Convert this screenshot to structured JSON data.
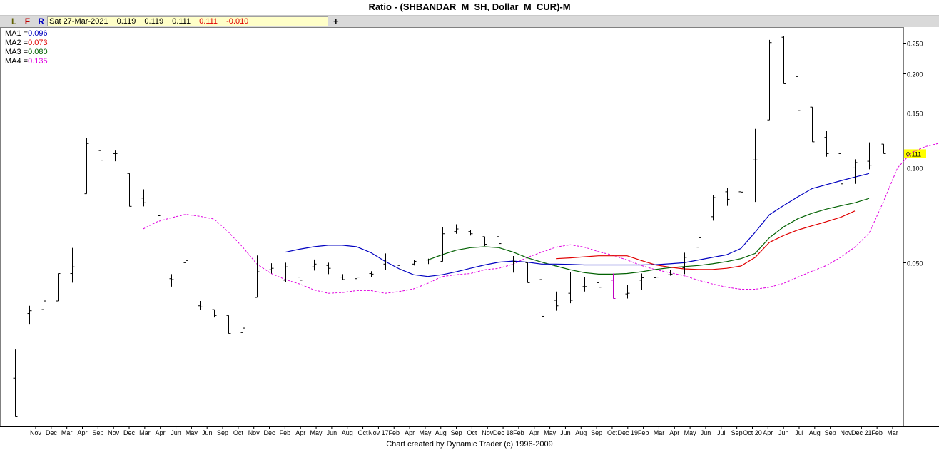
{
  "title": "Ratio - (SHBANDAR_M_SH, Dollar_M_CUR)-M",
  "toolbar": {
    "l": "L",
    "f": "F",
    "r": "R",
    "date": "Sat 27-Mar-2021",
    "open": "0.119",
    "high": "0.119",
    "low": "0.111",
    "close": "0.111",
    "change": "-0.010",
    "crosshair": "+"
  },
  "legend": [
    {
      "label": "MA1 =",
      "value": "0.096",
      "color": "#0000c0"
    },
    {
      "label": "MA2 =",
      "value": "0.073",
      "color": "#e00000"
    },
    {
      "label": "MA3 =",
      "value": "0.080",
      "color": "#006000"
    },
    {
      "label": "MA4 =",
      "value": "0.135",
      "color": "#e000e0"
    }
  ],
  "footer": "Chart created by Dynamic Trader  (c) 1996-2009",
  "chart_data": {
    "type": "ohlc",
    "y_scale": "log",
    "y_ticks": [
      "0.250",
      "0.200",
      "0.150",
      "0.100",
      "0.050"
    ],
    "y_tick_values": [
      0.25,
      0.2,
      0.15,
      0.1,
      0.05
    ],
    "last_price_label": "0.111",
    "last_price_color": "#ffff00",
    "x_labels": [
      "Nov",
      "Dec",
      "Mar",
      "Apr",
      "Sep",
      "Nov",
      "Dec",
      "Mar",
      "Apr",
      "Jun",
      "May",
      "Jun",
      "Sep",
      "Oct",
      "Nov",
      "Dec",
      "Feb",
      "Apr",
      "May",
      "Jun",
      "Aug",
      "Oct",
      "Nov 17",
      "Feb",
      "Apr",
      "May",
      "Aug",
      "Sep",
      "Oct",
      "Nov",
      "Dec 18",
      "Feb",
      "Apr",
      "May",
      "Jun",
      "Aug",
      "Sep",
      "Oct",
      "Dec 19",
      "Feb",
      "Mar",
      "Apr",
      "May",
      "Jun",
      "Jul",
      "Sep",
      "Oct 20",
      "Apr",
      "Jun",
      "Jul",
      "Aug",
      "Sep",
      "Nov",
      "Dec 21",
      "Feb",
      "Mar"
    ],
    "bars": [
      {
        "o": 0.0215,
        "h": 0.0265,
        "l": 0.0162,
        "c": 0.0162
      },
      {
        "o": 0.0345,
        "h": 0.0365,
        "l": 0.0318,
        "c": 0.0352
      },
      {
        "o": 0.0355,
        "h": 0.0382,
        "l": 0.0352,
        "c": 0.0378
      },
      {
        "o": 0.0378,
        "h": 0.0462,
        "l": 0.0378,
        "c": 0.0462
      },
      {
        "o": 0.0462,
        "h": 0.0557,
        "l": 0.0432,
        "c": 0.0485
      },
      {
        "o": 0.0828,
        "h": 0.1248,
        "l": 0.0828,
        "c": 0.1195
      },
      {
        "o": 0.1135,
        "h": 0.1165,
        "l": 0.1045,
        "c": 0.1058
      },
      {
        "o": 0.111,
        "h": 0.1135,
        "l": 0.105,
        "c": 0.111
      },
      {
        "o": 0.096,
        "h": 0.096,
        "l": 0.0755,
        "c": 0.0755
      },
      {
        "o": 0.0802,
        "h": 0.0855,
        "l": 0.0755,
        "c": 0.0775
      },
      {
        "o": 0.0735,
        "h": 0.0735,
        "l": 0.0668,
        "c": 0.0705
      },
      {
        "o": 0.0445,
        "h": 0.046,
        "l": 0.042,
        "c": 0.0442
      },
      {
        "o": 0.05,
        "h": 0.0562,
        "l": 0.0442,
        "c": 0.0508
      },
      {
        "o": 0.0365,
        "h": 0.0378,
        "l": 0.0355,
        "c": 0.0362
      },
      {
        "o": 0.0355,
        "h": 0.0355,
        "l": 0.0335,
        "c": 0.034
      },
      {
        "o": 0.034,
        "h": 0.034,
        "l": 0.0298,
        "c": 0.0298
      },
      {
        "o": 0.03,
        "h": 0.0318,
        "l": 0.0292,
        "c": 0.031
      },
      {
        "o": 0.0388,
        "h": 0.0527,
        "l": 0.0388,
        "c": 0.0468
      },
      {
        "o": 0.0475,
        "h": 0.0498,
        "l": 0.0462,
        "c": 0.048
      },
      {
        "o": 0.044,
        "h": 0.05,
        "l": 0.0435,
        "c": 0.0485
      },
      {
        "o": 0.045,
        "h": 0.046,
        "l": 0.0432,
        "c": 0.044
      },
      {
        "o": 0.0485,
        "h": 0.0512,
        "l": 0.0472,
        "c": 0.0495
      },
      {
        "o": 0.049,
        "h": 0.05,
        "l": 0.046,
        "c": 0.048
      },
      {
        "o": 0.045,
        "h": 0.046,
        "l": 0.0442,
        "c": 0.0442
      },
      {
        "o": 0.0445,
        "h": 0.0455,
        "l": 0.0442,
        "c": 0.045
      },
      {
        "o": 0.0462,
        "h": 0.047,
        "l": 0.045,
        "c": 0.046
      },
      {
        "o": 0.0495,
        "h": 0.0535,
        "l": 0.0475,
        "c": 0.051
      },
      {
        "o": 0.049,
        "h": 0.0505,
        "l": 0.0465,
        "c": 0.0475
      },
      {
        "o": 0.0495,
        "h": 0.051,
        "l": 0.049,
        "c": 0.0505
      },
      {
        "o": 0.051,
        "h": 0.0515,
        "l": 0.0495,
        "c": 0.051
      },
      {
        "o": 0.0505,
        "h": 0.065,
        "l": 0.0505,
        "c": 0.0618
      },
      {
        "o": 0.0628,
        "h": 0.0662,
        "l": 0.0618,
        "c": 0.064
      },
      {
        "o": 0.0628,
        "h": 0.0635,
        "l": 0.061,
        "c": 0.0618
      },
      {
        "o": 0.0605,
        "h": 0.0605,
        "l": 0.0565,
        "c": 0.0572
      },
      {
        "o": 0.0605,
        "h": 0.0605,
        "l": 0.0572,
        "c": 0.0575
      },
      {
        "o": 0.051,
        "h": 0.0525,
        "l": 0.0465,
        "c": 0.0505
      },
      {
        "o": 0.05,
        "h": 0.05,
        "l": 0.0432,
        "c": 0.0432
      },
      {
        "o": 0.0442,
        "h": 0.0442,
        "l": 0.0338,
        "c": 0.0338
      },
      {
        "o": 0.038,
        "h": 0.0405,
        "l": 0.0352,
        "c": 0.0365
      },
      {
        "o": 0.04,
        "h": 0.0468,
        "l": 0.0372,
        "c": 0.038
      },
      {
        "o": 0.042,
        "h": 0.045,
        "l": 0.0405,
        "c": 0.042
      },
      {
        "o": 0.0432,
        "h": 0.0458,
        "l": 0.041,
        "c": 0.0418
      },
      {
        "o": 0.044,
        "h": 0.0462,
        "l": 0.0385,
        "c": 0.0385
      },
      {
        "o": 0.0398,
        "h": 0.0425,
        "l": 0.0385,
        "c": 0.04
      },
      {
        "o": 0.044,
        "h": 0.0462,
        "l": 0.041,
        "c": 0.0448
      },
      {
        "o": 0.0448,
        "h": 0.0462,
        "l": 0.0435,
        "c": 0.045
      },
      {
        "o": 0.0458,
        "h": 0.0475,
        "l": 0.0455,
        "c": 0.046
      },
      {
        "o": 0.0482,
        "h": 0.0538,
        "l": 0.046,
        "c": 0.052
      },
      {
        "o": 0.056,
        "h": 0.061,
        "l": 0.054,
        "c": 0.06
      },
      {
        "o": 0.07,
        "h": 0.082,
        "l": 0.068,
        "c": 0.0805
      },
      {
        "o": 0.084,
        "h": 0.0865,
        "l": 0.0758,
        "c": 0.0795
      },
      {
        "o": 0.084,
        "h": 0.0865,
        "l": 0.081,
        "c": 0.0838
      },
      {
        "o": 0.106,
        "h": 0.133,
        "l": 0.078,
        "c": 0.106
      },
      {
        "o": 0.142,
        "h": 0.255,
        "l": 0.142,
        "c": 0.25
      },
      {
        "o": 0.26,
        "h": 0.262,
        "l": 0.185,
        "c": 0.185
      },
      {
        "o": 0.195,
        "h": 0.195,
        "l": 0.152,
        "c": 0.152
      },
      {
        "o": 0.156,
        "h": 0.156,
        "l": 0.121,
        "c": 0.121
      },
      {
        "o": 0.125,
        "h": 0.131,
        "l": 0.1085,
        "c": 0.111
      },
      {
        "o": 0.111,
        "h": 0.116,
        "l": 0.087,
        "c": 0.089
      },
      {
        "o": 0.1,
        "h": 0.1065,
        "l": 0.089,
        "c": 0.104
      },
      {
        "o": 0.105,
        "h": 0.1205,
        "l": 0.099,
        "c": 0.102
      },
      {
        "o": 0.119,
        "h": 0.119,
        "l": 0.111,
        "c": 0.111
      }
    ],
    "ma1": {
      "name": "MA1",
      "color": "#0000c0",
      "style": "solid",
      "start": 19,
      "values": [
        0.054,
        0.0552,
        0.0562,
        0.0568,
        0.0568,
        0.0562,
        0.0538,
        0.0505,
        0.0478,
        0.0458,
        0.0452,
        0.0458,
        0.0468,
        0.048,
        0.0492,
        0.0502,
        0.0506,
        0.0502,
        0.0495,
        0.0495,
        0.0494,
        0.0492,
        0.0492,
        0.0492,
        0.0492,
        0.0492,
        0.0493,
        0.0496,
        0.05,
        0.051,
        0.052,
        0.053,
        0.0555,
        0.0625,
        0.071,
        0.076,
        0.081,
        0.086,
        0.0885,
        0.091,
        0.0935,
        0.096
      ]
    },
    "ma2": {
      "name": "MA2",
      "color": "#e00000",
      "style": "solid",
      "start": 38,
      "values": [
        0.0515,
        0.0518,
        0.0522,
        0.0526,
        0.0526,
        0.0526,
        0.0508,
        0.0492,
        0.0484,
        0.0478,
        0.0476,
        0.0476,
        0.048,
        0.0488,
        0.052,
        0.058,
        0.061,
        0.0635,
        0.0655,
        0.0675,
        0.0697,
        0.073
      ]
    },
    "ma3": {
      "name": "MA3",
      "color": "#006000",
      "style": "solid",
      "start": 29,
      "values": [
        0.051,
        0.053,
        0.0548,
        0.0558,
        0.0562,
        0.0558,
        0.054,
        0.0518,
        0.0502,
        0.0488,
        0.0475,
        0.0465,
        0.046,
        0.046,
        0.0462,
        0.0468,
        0.0476,
        0.0482,
        0.0486,
        0.049,
        0.0496,
        0.0504,
        0.0515,
        0.0535,
        0.06,
        0.065,
        0.069,
        0.0718,
        0.074,
        0.0758,
        0.0775,
        0.08
      ]
    },
    "ma4": {
      "name": "MA4",
      "color": "#e000e0",
      "style": "dashed",
      "start": 9,
      "values": [
        0.064,
        0.0675,
        0.0695,
        0.0712,
        0.0702,
        0.0688,
        0.0625,
        0.056,
        0.0495,
        0.0462,
        0.0442,
        0.0428,
        0.041,
        0.04,
        0.0402,
        0.0408,
        0.0408,
        0.04,
        0.0405,
        0.0413,
        0.043,
        0.0452,
        0.0458,
        0.0462,
        0.0475,
        0.048,
        0.0495,
        0.052,
        0.054,
        0.056,
        0.057,
        0.056,
        0.0542,
        0.0528,
        0.051,
        0.049,
        0.0475,
        0.0465,
        0.0455,
        0.044,
        0.0428,
        0.0418,
        0.0412,
        0.0412,
        0.0418,
        0.043,
        0.045,
        0.047,
        0.049,
        0.052,
        0.056,
        0.062,
        0.078,
        0.1,
        0.112,
        0.117,
        0.12,
        0.123,
        0.125,
        0.127,
        0.131,
        0.135
      ]
    }
  }
}
